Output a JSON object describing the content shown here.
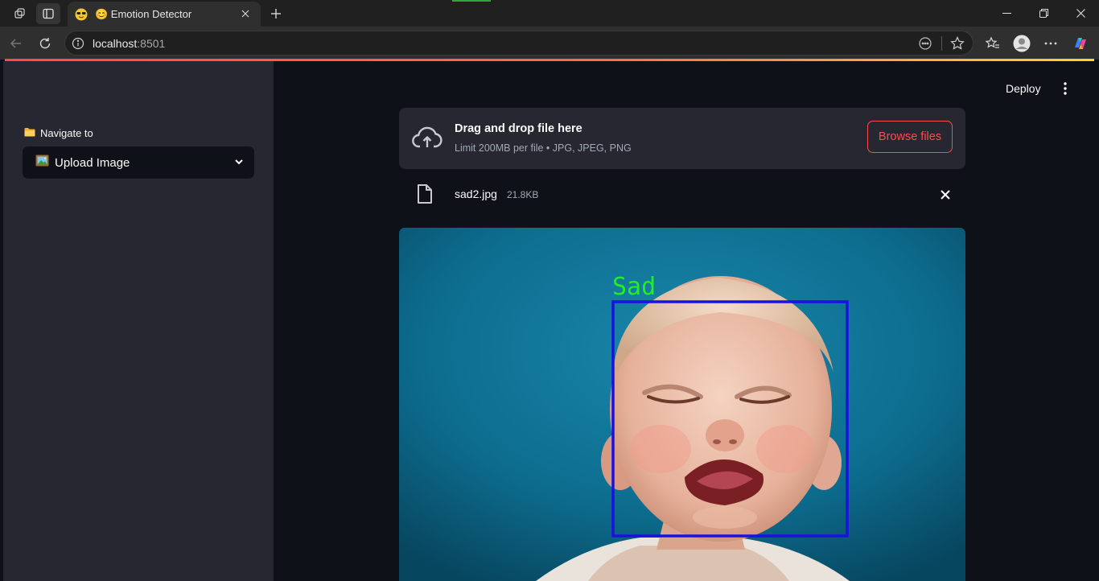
{
  "browser": {
    "tab": {
      "title": "😊 Emotion Detector",
      "favicon": "sunglasses-emoji"
    },
    "address": {
      "host": "localhost",
      "port": ":8501"
    }
  },
  "sidebar": {
    "nav_label": "Navigate to",
    "nav_icon": "📂",
    "select": {
      "icon": "🖼️",
      "value": "Upload Image"
    }
  },
  "header": {
    "deploy_label": "Deploy"
  },
  "uploader": {
    "title": "Drag and drop file here",
    "limit": "Limit 200MB per file • JPG, JPEG, PNG",
    "browse_label": "Browse files"
  },
  "file": {
    "name": "sad2.jpg",
    "size": "21.8KB"
  },
  "result": {
    "emotion_label": "Sad",
    "box_color": "#1a10e0",
    "label_color": "#22ee22"
  },
  "colors": {
    "accent": "#ff4b4b",
    "sidebar_bg": "#262730",
    "app_bg": "#0e1117"
  }
}
